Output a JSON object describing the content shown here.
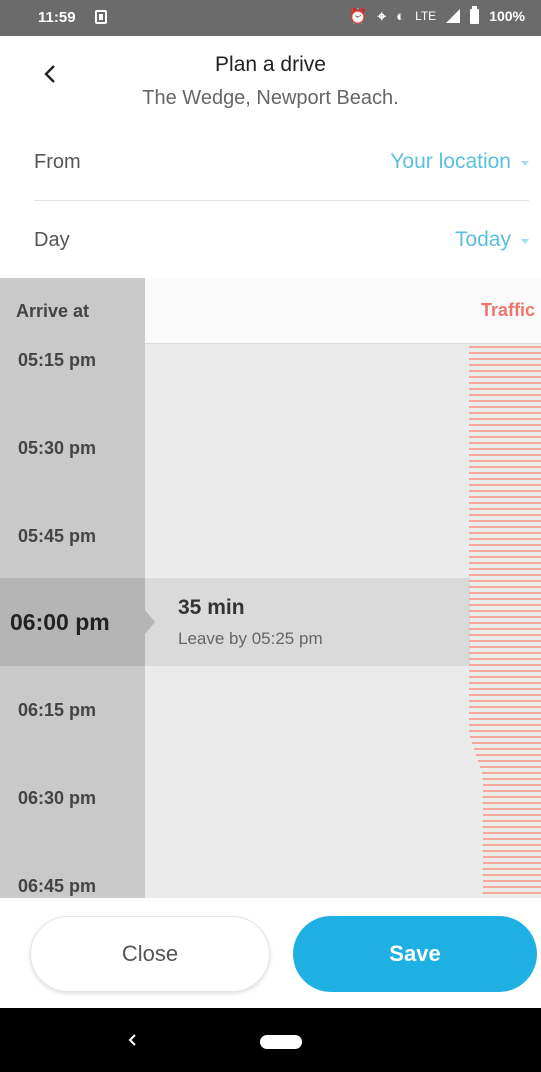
{
  "status_bar": {
    "time": "11:59",
    "network": "LTE",
    "battery": "100%",
    "icons": [
      "sim-icon",
      "alarm-icon",
      "location-icon",
      "data-saver-icon",
      "signal-icon",
      "battery-icon"
    ]
  },
  "header": {
    "title": "Plan a drive",
    "subtitle": "The Wedge, Newport Beach."
  },
  "form": {
    "from_label": "From",
    "from_value": "Your location",
    "day_label": "Day",
    "day_value": "Today"
  },
  "schedule": {
    "arrive_header": "Arrive at",
    "traffic_header": "Traffic",
    "times": [
      "05:15 pm",
      "05:30 pm",
      "05:45 pm",
      "06:00 pm",
      "06:15 pm",
      "06:30 pm",
      "06:45 pm"
    ],
    "selected_time": "06:00 pm",
    "trip_duration": "35 min",
    "leave_by": "Leave by 05:25 pm"
  },
  "buttons": {
    "close": "Close",
    "save": "Save"
  },
  "colors": {
    "accent": "#1fb0e3",
    "link": "#58c0e0",
    "traffic": "#f0766d",
    "traffic_bar": "#f6a99a"
  }
}
